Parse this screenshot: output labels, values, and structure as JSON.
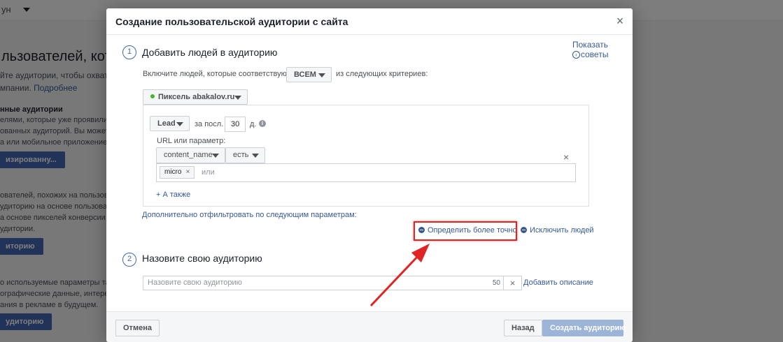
{
  "background": {
    "account_label": "ун",
    "heading": "льзователей, которы",
    "paragraph_lines": [
      "йте аудитории, чтобы охватыв",
      "мпании."
    ],
    "learn_more": "Подробнее",
    "section1_title": "нные аудитории",
    "section1_lines": [
      "елями, которые уже проявили инт",
      "ованных аудиторий. Вы можете со",
      "а или мобильное приложение."
    ],
    "section1_button": "изированну...",
    "section2_lines": [
      "ователей, похожих на пользовате",
      "удиторию на основе пользователе",
      "а основе пикселей конверсии или",
      "удитории."
    ],
    "section2_button": "иторию",
    "section3_lines": [
      "о используемые параметры таргет",
      "ографические данные, интересы",
      "ания в рекламе в будущем."
    ],
    "section3_button": "удиторию"
  },
  "dialog": {
    "title": "Создание пользовательской аудитории с сайта",
    "close_icon": "×",
    "tips": {
      "line1": "Показать",
      "line2": "советы",
      "chevron": "‹"
    },
    "step1": {
      "number": "1",
      "title": "Добавить людей в аудиторию",
      "include_prefix": "Включите людей, которые соответствуют",
      "match_select": "ВСЕМ",
      "include_suffix": "из следующих критериев:",
      "pixel_select": "Пиксель abakalov.ru",
      "event_select": "Lead",
      "for_last_label": "за посл.",
      "days_value": "30",
      "days_unit": "д.",
      "info_icon": "i",
      "url_param_label": "URL или параметр:",
      "param_select": "content_name",
      "operator_select": "есть",
      "tag_value": "micro",
      "tag_remove": "×",
      "or_placeholder": "или",
      "row_remove": "×",
      "add_also": "+ А также",
      "filter_more": "Дополнительно отфильтровать по следующим параметрам:",
      "refine_link": "Определить более точно",
      "exclude_link": "Исключить людей"
    },
    "step2": {
      "number": "2",
      "title": "Назовите свою аудиторию",
      "name_placeholder": "Назовите свою аудиторию",
      "char_count": "50",
      "clear_icon": "×",
      "add_description": "Добавить описание"
    },
    "footer": {
      "cancel": "Отмена",
      "back": "Назад",
      "create": "Создать аудиторию"
    }
  },
  "colors": {
    "accent": "#4267b2",
    "link": "#365899",
    "highlight": "#e02424",
    "pixel_active": "#42b72a"
  }
}
